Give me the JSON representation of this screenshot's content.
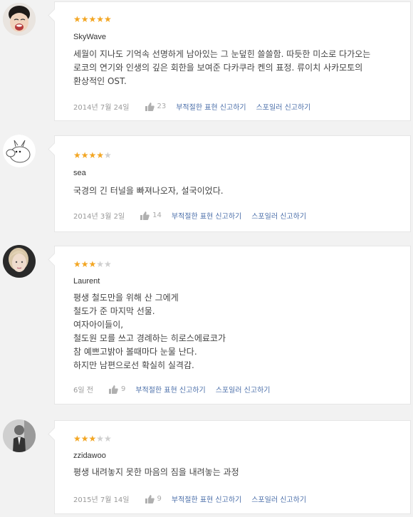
{
  "reviews": [
    {
      "avatar_icon": "crying-child-avatar-icon",
      "rating": 5,
      "stars": "★★★★★",
      "stars_off": "",
      "nickname": "SkyWave",
      "text": "세월이 지나도 기억속 선명하게 남아있는 그 눈덮힌 쓸쓸함. 따듯한 미소로 다가오는\n로코의 연기와 인생의 깊은 회한을 보여준 다카쿠라 켄의 표정. 류이치 사카모토의\n환상적인 OST.",
      "date": "2014년 7월 24일",
      "likes": "23",
      "report_label": "부적절한 표현 신고하기",
      "spoiler_label": "스포일러 신고하기"
    },
    {
      "avatar_icon": "moomin-avatar-icon",
      "rating": 4,
      "stars": "★★★★",
      "stars_off": "★",
      "nickname": "sea",
      "text": "국경의 긴 터널을 빠져나오자, 설국이었다.",
      "date": "2014년 3월 2일",
      "likes": "14",
      "report_label": "부적절한 표현 신고하기",
      "spoiler_label": "스포일러 신고하기"
    },
    {
      "avatar_icon": "woman-portrait-avatar-icon",
      "rating": 3,
      "stars": "★★★",
      "stars_off": "★★",
      "nickname": "Laurent",
      "text": "평생 철도만을 위해 산 그에게\n철도가 준 마지막 선물.\n여자아이들이,\n철도원 모를 쓰고 경례하는 히로스에료코가\n참 예쁘고밝아 볼때마다 눈물 난다.\n하지만 남편으로선 확실히 실격감.",
      "date": "6일 전",
      "likes": "9",
      "report_label": "부적절한 표현 신고하기",
      "spoiler_label": "스포일러 신고하기"
    },
    {
      "avatar_icon": "man-bw-avatar-icon",
      "rating": 3,
      "stars": "★★★",
      "stars_off": "★★",
      "nickname": "zzidawoo",
      "text": "평생 내려놓지 못한 마음의 짐을 내려놓는 과정",
      "date": "2015년 7월 14일",
      "likes": "9",
      "report_label": "부적절한 표현 신고하기",
      "spoiler_label": "스포일러 신고하기"
    }
  ],
  "colors": {
    "star_on": "#f3a623",
    "star_off": "#cfcfcf",
    "link": "#4a6ea9"
  }
}
